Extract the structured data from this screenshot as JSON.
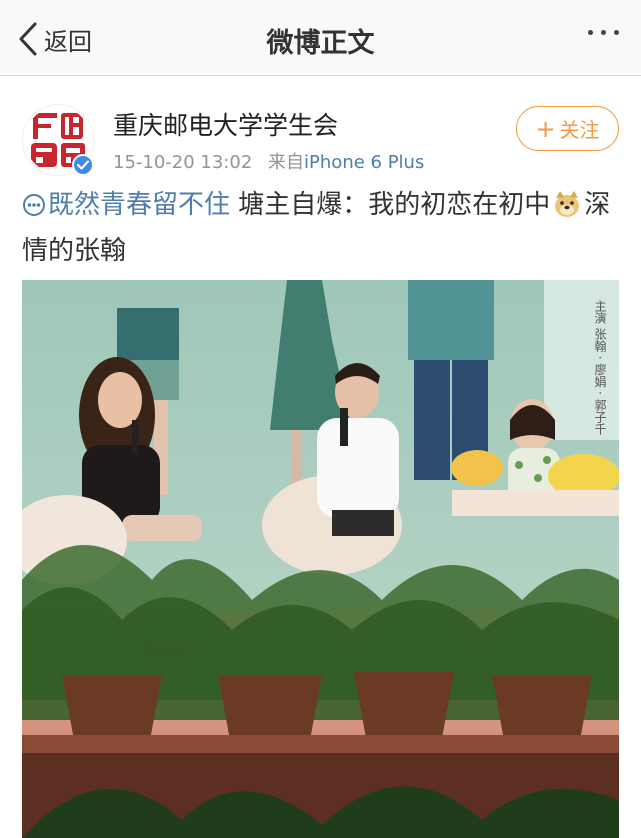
{
  "nav": {
    "back_label": "返回",
    "title": "微博正文"
  },
  "post": {
    "author": "重庆邮电大学学生会",
    "time": "15-10-20 13:02",
    "source_prefix": "来自",
    "device": "iPhone 6 Plus",
    "follow_label": "关注",
    "topic": "既然青春留不住",
    "text_part1": " 塘主自爆：我的初恋在初中",
    "text_part2": "深情的张翰",
    "poster_text": "主演 张翰 · 廖娟 · 郭子千"
  },
  "colors": {
    "accent_orange": "#f29a3c",
    "link_blue": "#507daf",
    "verified_blue": "#3d8be8",
    "avatar_red": "#c8262e"
  },
  "icons": {
    "back": "chevron-left-icon",
    "more": "more-dots-icon",
    "verified": "verified-badge-icon",
    "topic": "topic-icon",
    "emoji": "doge-emoji-icon"
  }
}
